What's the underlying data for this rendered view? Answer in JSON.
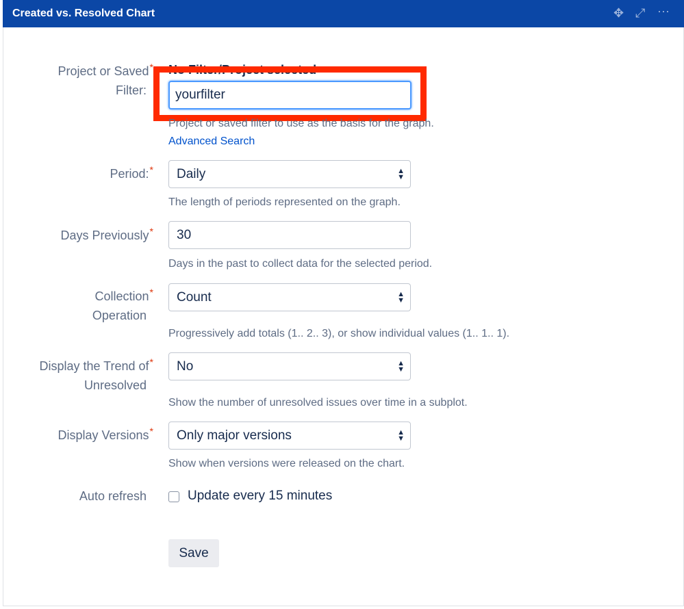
{
  "header": {
    "title": "Created vs. Resolved Chart",
    "icons": [
      "move-icon",
      "expand-icon",
      "more-icon"
    ]
  },
  "form": {
    "project": {
      "label_line1": "Project or Saved",
      "label_line2": "Filter:",
      "selected": "No Filter/Project selected",
      "value": "yourfilter",
      "help": "Project or saved filter to use as the basis for the graph.",
      "link": "Advanced Search"
    },
    "period": {
      "label": "Period:",
      "value": "Daily",
      "help": "The length of periods represented on the graph."
    },
    "days": {
      "label": "Days Previously",
      "value": "30",
      "help": "Days in the past to collect data for the selected period."
    },
    "collection": {
      "label_line1": "Collection",
      "label_line2": "Operation",
      "value": "Count",
      "help": "Progressively add totals (1.. 2.. 3), or show individual values (1.. 1.. 1)."
    },
    "trend": {
      "label_line1": "Display the Trend of",
      "label_line2": "Unresolved",
      "value": "No",
      "help": "Show the number of unresolved issues over time in a subplot."
    },
    "versions": {
      "label": "Display Versions",
      "value": "Only major versions",
      "help": "Show when versions were released on the chart."
    },
    "refresh": {
      "label": "Auto refresh",
      "checkbox_label": "Update every 15 minutes",
      "checked": false
    },
    "required_mark": "*",
    "save": "Save"
  },
  "colors": {
    "header": "#0b47a6",
    "highlight": "#ff2a00",
    "link": "#0052cc"
  }
}
